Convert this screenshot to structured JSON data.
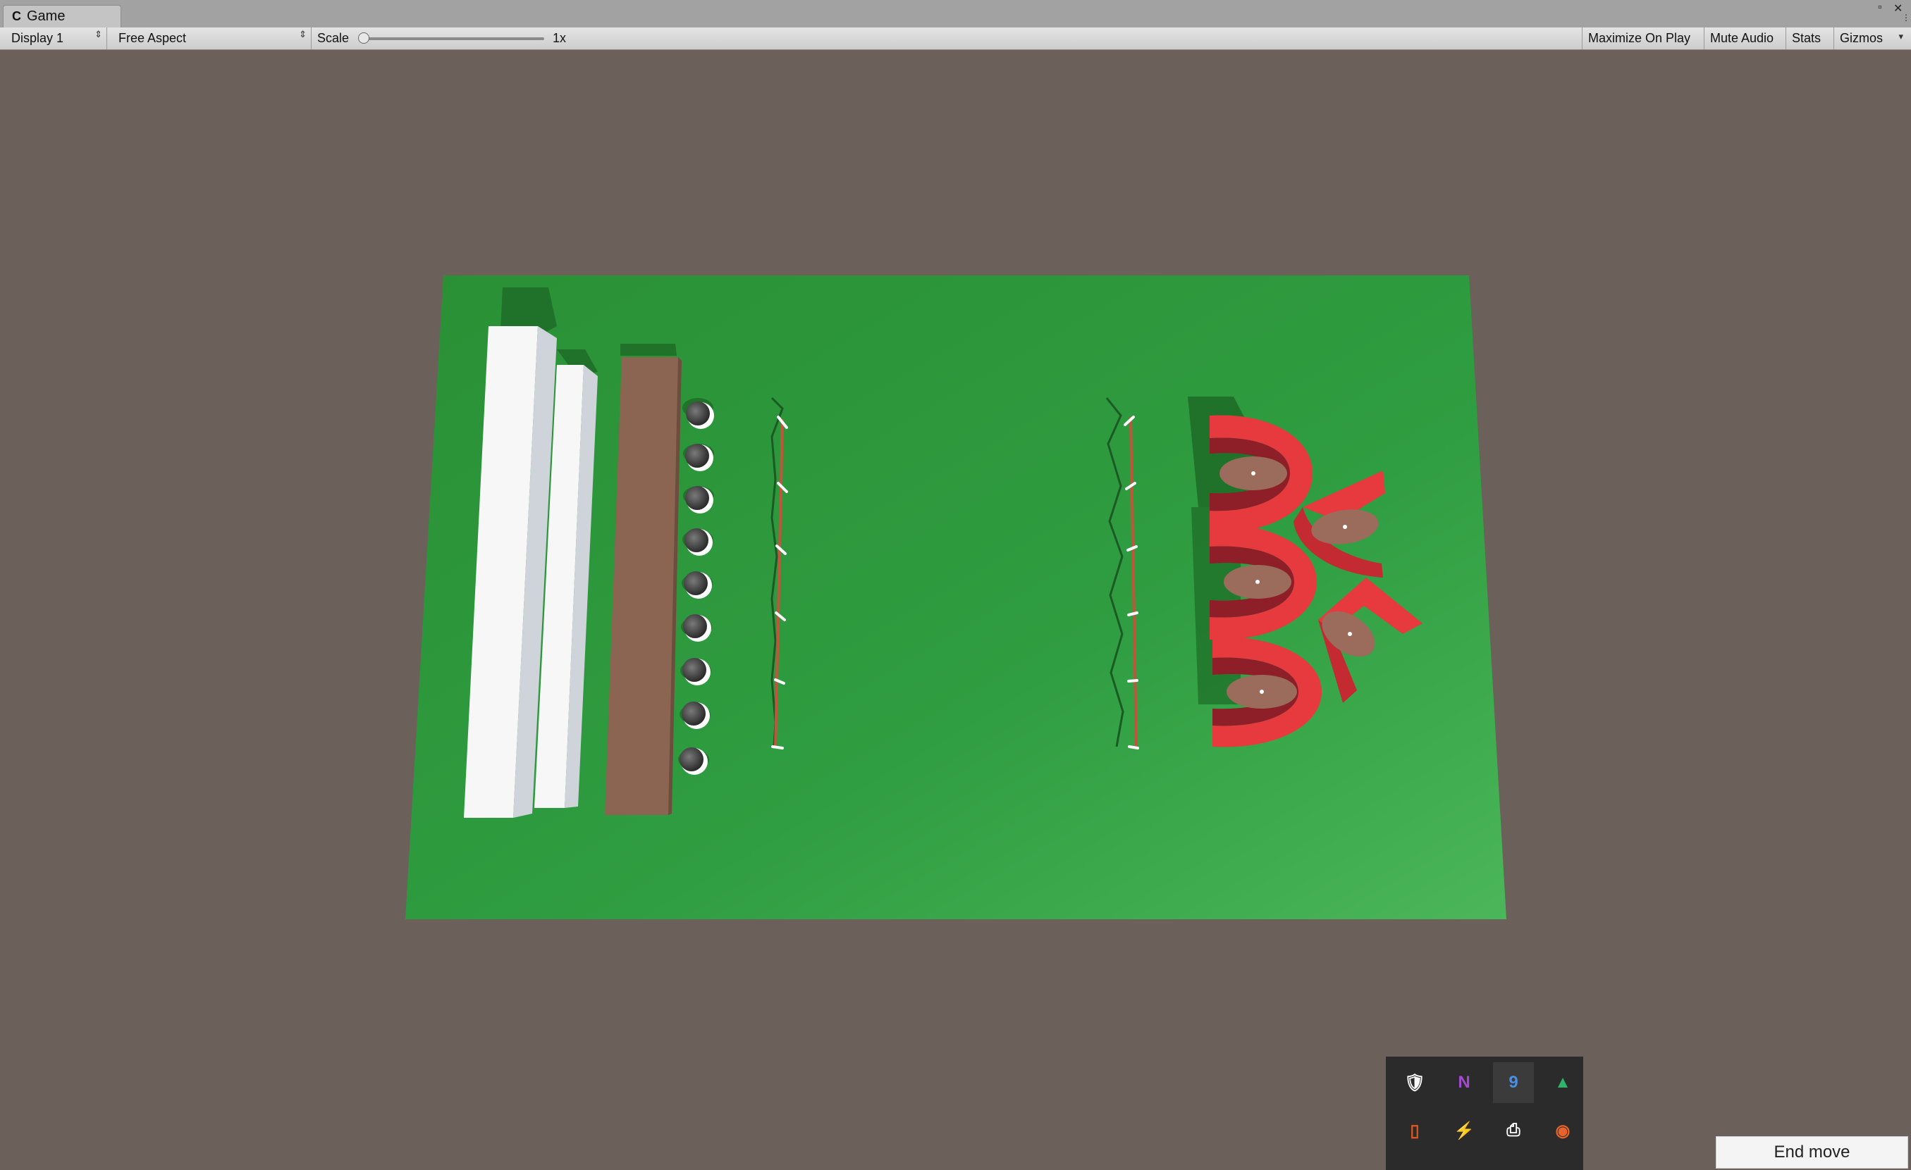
{
  "window": {
    "tab_title": "Game",
    "tab_glyph": "C",
    "controls": {
      "maximize": "▫",
      "close": "✕",
      "menu": "⋮"
    }
  },
  "toolbar": {
    "display_value": "Display 1",
    "aspect_value": "Free Aspect",
    "scale_label": "Scale",
    "scale_value": "1x",
    "maximize_on_play": "Maximize On Play",
    "mute_audio": "Mute Audio",
    "stats": "Stats",
    "gizmos": "Gizmos",
    "dropdown_arrow": "▾",
    "stepper_arrows": "⇕"
  },
  "scene": {
    "colors": {
      "background": "#6b605a",
      "ground": "#2e9a40",
      "pillar": "#f2f2f2",
      "plank": "#8b6452",
      "ball": "#3c3c3c",
      "rope": "#b05a3f",
      "magnet": "#e8383c"
    },
    "objects": [
      "white-pillars",
      "brown-plank",
      "ball-column",
      "rope-fence-left",
      "rope-fence-right",
      "red-magnets"
    ]
  },
  "tray": {
    "icons": [
      {
        "name": "shield-icon",
        "glyph": "🛡",
        "color": "#ffffff"
      },
      {
        "name": "onenote-icon",
        "glyph": "N",
        "color": "#a34bd0"
      },
      {
        "name": "app-blue-icon",
        "glyph": "9",
        "color": "#4a90e2"
      },
      {
        "name": "google-drive-icon",
        "glyph": "▲",
        "color": "#2fb36a"
      },
      {
        "name": "office-icon",
        "glyph": "▯",
        "color": "#e2571e"
      },
      {
        "name": "orange-app-icon",
        "glyph": "⚡",
        "color": "#f28c18"
      },
      {
        "name": "printer-icon",
        "glyph": "⎙",
        "color": "#ffffff"
      },
      {
        "name": "firefox-icon",
        "glyph": "◉",
        "color": "#e8632b"
      }
    ]
  },
  "end_move_label": "End move"
}
